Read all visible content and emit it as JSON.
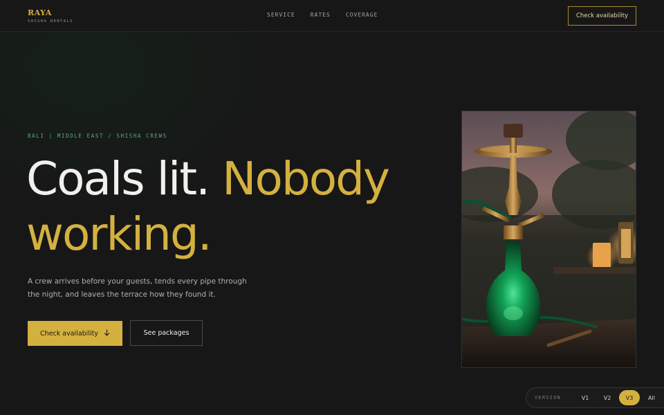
{
  "brand": {
    "name": "RAYA",
    "tagline": "SHISHA RENTALS"
  },
  "nav": {
    "items": [
      "SERVICE",
      "RATES",
      "COVERAGE"
    ]
  },
  "header": {
    "cta_label": "Check availability"
  },
  "hero": {
    "eyebrow": "BALI | MIDDLE EAST / SHISHA CREWS",
    "headline_white": "Coals lit. ",
    "headline_gold_1": "Nobody",
    "headline_gold_2": "working.",
    "lede": "A crew arrives before your guests, tends every pipe through the night, and leaves the terrace how they found it.",
    "primary_label": "Check availability",
    "primary_icon": "arrow-down-icon",
    "secondary_label": "See packages",
    "image_subject": "green glass shisha hookah with brass stem on a wooden terrace table at dusk"
  },
  "version_switcher": {
    "label": "VERSION",
    "options": [
      "V1",
      "V2",
      "V3",
      "All"
    ],
    "active": "V3"
  },
  "colors": {
    "background": "#171717",
    "accent_gold": "#d4b13f",
    "eyebrow_green": "#5ea97e",
    "text_light": "#f2f0ec"
  }
}
